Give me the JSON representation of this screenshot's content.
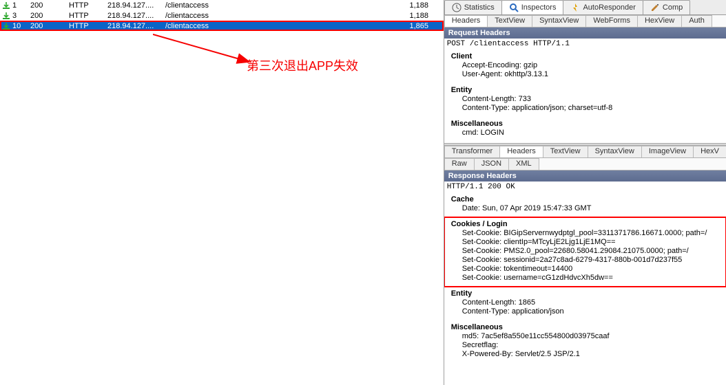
{
  "sessions": [
    {
      "id": "1",
      "status": "200",
      "protocol": "HTTP",
      "host": "218.94.127....",
      "url": "/clientaccess",
      "size": "1,188",
      "selected": false,
      "red_outline": false
    },
    {
      "id": "3",
      "status": "200",
      "protocol": "HTTP",
      "host": "218.94.127....",
      "url": "/clientaccess",
      "size": "1,188",
      "selected": false,
      "red_outline": false
    },
    {
      "id": "10",
      "status": "200",
      "protocol": "HTTP",
      "host": "218.94.127....",
      "url": "/clientaccess",
      "size": "1,865",
      "selected": true,
      "red_outline": true
    }
  ],
  "annotation_text": "第三次退出APP失效",
  "top_tabs": {
    "statistics": "Statistics",
    "inspectors": "Inspectors",
    "autoresponder": "AutoResponder",
    "composer": "Comp"
  },
  "request_sub_tabs": [
    "Headers",
    "TextView",
    "SyntaxView",
    "WebForms",
    "HexView",
    "Auth"
  ],
  "request_sub_active": 0,
  "request_header_bar": "Request Headers",
  "request_raw_line": "POST /clientaccess HTTP/1.1",
  "request_groups": [
    {
      "title": "Client",
      "items": [
        "Accept-Encoding: gzip",
        "User-Agent: okhttp/3.13.1"
      ]
    },
    {
      "title": "Entity",
      "items": [
        "Content-Length: 733",
        "Content-Type: application/json; charset=utf-8"
      ]
    },
    {
      "title": "Miscellaneous",
      "items": [
        "cmd: LOGIN"
      ]
    }
  ],
  "response_sub_tabs_row1": [
    "Transformer",
    "Headers",
    "TextView",
    "SyntaxView",
    "ImageView",
    "HexV"
  ],
  "response_sub_tabs_row1_active": 1,
  "response_sub_tabs_row2": [
    "Raw",
    "JSON",
    "XML"
  ],
  "response_header_bar": "Response Headers",
  "response_raw_line": "HTTP/1.1 200 OK",
  "response_groups": [
    {
      "title": "Cache",
      "items": [
        "Date: Sun, 07 Apr 2019 15:47:33 GMT"
      ],
      "highlight": false
    },
    {
      "title": "Cookies / Login",
      "items": [
        "Set-Cookie: BIGipServernwydptgl_pool=3311371786.16671.0000; path=/",
        "Set-Cookie: clientIp=MTcyLjE2Ljg1LjE1MQ==",
        "Set-Cookie: PMS2.0_pool=22680.58041.29084.21075.0000; path=/",
        "Set-Cookie: sessionid=2a27c8ad-6279-4317-880b-001d7d237f55",
        "Set-Cookie: tokentimeout=14400",
        "Set-Cookie: username=cG1zdHdvcXh5dw=="
      ],
      "highlight": true
    },
    {
      "title": "Entity",
      "items": [
        "Content-Length: 1865",
        "Content-Type: application/json"
      ],
      "highlight": false
    },
    {
      "title": "Miscellaneous",
      "items": [
        "md5: 7ac5ef8a550e11cc554800d03975caaf",
        "Secretflag:",
        "X-Powered-By: Servlet/2.5 JSP/2.1"
      ],
      "highlight": false
    }
  ]
}
